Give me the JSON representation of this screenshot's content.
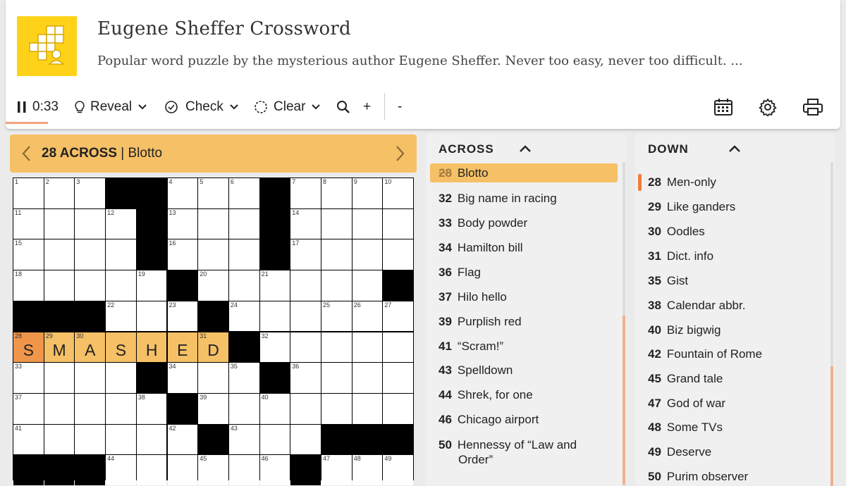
{
  "app": {
    "title": "Eugene Sheffer Crossword",
    "description": "Popular word puzzle by the mysterious author Eugene Sheffer. Never too easy, never too difficult. ..."
  },
  "toolbar": {
    "timer": "0:33",
    "reveal": "Reveal",
    "check": "Check",
    "clear": "Clear",
    "zoom_in": "+",
    "zoom_out": "-"
  },
  "current_clue": {
    "number_dir": "28 ACROSS",
    "separator": " | ",
    "text": "Blotto"
  },
  "grid": {
    "rows": [
      "...##...#....",
      "....#...#....",
      "....#...#....",
      ".....#......#",
      "###...#......",
      ".......#.....",
      "....#...#....",
      ".....#.......",
      "......#...###",
      "###......#..."
    ],
    "numbers": [
      [
        1,
        2,
        3,
        0,
        0,
        4,
        5,
        6,
        0,
        7,
        8,
        9,
        10
      ],
      [
        11,
        0,
        0,
        12,
        0,
        13,
        0,
        0,
        0,
        14,
        0,
        0,
        0
      ],
      [
        15,
        0,
        0,
        0,
        0,
        16,
        0,
        0,
        0,
        17,
        0,
        0,
        0
      ],
      [
        18,
        0,
        0,
        0,
        19,
        0,
        20,
        0,
        21,
        0,
        0,
        0,
        0
      ],
      [
        0,
        0,
        0,
        22,
        0,
        23,
        0,
        24,
        0,
        0,
        25,
        26,
        27
      ],
      [
        28,
        29,
        30,
        0,
        0,
        0,
        31,
        0,
        32,
        0,
        0,
        0,
        0
      ],
      [
        33,
        0,
        0,
        0,
        0,
        34,
        0,
        35,
        0,
        36,
        0,
        0,
        0
      ],
      [
        37,
        0,
        0,
        0,
        38,
        0,
        39,
        0,
        40,
        0,
        0,
        0,
        0
      ],
      [
        41,
        0,
        0,
        0,
        0,
        42,
        0,
        43,
        0,
        0,
        0,
        0,
        0
      ],
      [
        0,
        0,
        0,
        44,
        0,
        0,
        45,
        0,
        46,
        0,
        47,
        48,
        49
      ]
    ],
    "entry_row": 5,
    "entry_letters": [
      "S",
      "M",
      "A",
      "S",
      "H",
      "E",
      "D"
    ],
    "cursor_col": 0
  },
  "across": {
    "title": "ACROSS",
    "clues": [
      {
        "n": "28",
        "text": "Blotto",
        "active": true
      },
      {
        "n": "32",
        "text": "Big name in racing"
      },
      {
        "n": "33",
        "text": "Body powder"
      },
      {
        "n": "34",
        "text": "Hamilton bill"
      },
      {
        "n": "36",
        "text": "Flag"
      },
      {
        "n": "37",
        "text": "Hilo hello"
      },
      {
        "n": "39",
        "text": "Purplish red"
      },
      {
        "n": "41",
        "text": "“Scram!”"
      },
      {
        "n": "43",
        "text": "Spelldown"
      },
      {
        "n": "44",
        "text": "Shrek, for one"
      },
      {
        "n": "46",
        "text": "Chicago airport"
      },
      {
        "n": "50",
        "text": "Hennessy of “Law and",
        "text2": "Order”"
      }
    ]
  },
  "down": {
    "title": "DOWN",
    "clues": [
      {
        "n": "28",
        "text": "Men-only",
        "marked": true
      },
      {
        "n": "29",
        "text": "Like ganders"
      },
      {
        "n": "30",
        "text": "Oodles"
      },
      {
        "n": "31",
        "text": "Dict. info"
      },
      {
        "n": "35",
        "text": "Gist"
      },
      {
        "n": "38",
        "text": "Calendar abbr."
      },
      {
        "n": "40",
        "text": "Biz bigwig"
      },
      {
        "n": "42",
        "text": "Fountain of Rome"
      },
      {
        "n": "45",
        "text": "Grand tale"
      },
      {
        "n": "47",
        "text": "God of war"
      },
      {
        "n": "48",
        "text": "Some TVs"
      },
      {
        "n": "49",
        "text": "Deserve"
      },
      {
        "n": "50",
        "text": "Purim observer"
      }
    ]
  },
  "colors": {
    "accent": "#f5c066",
    "cursor": "#f0964a",
    "logo": "#ffd21a"
  }
}
